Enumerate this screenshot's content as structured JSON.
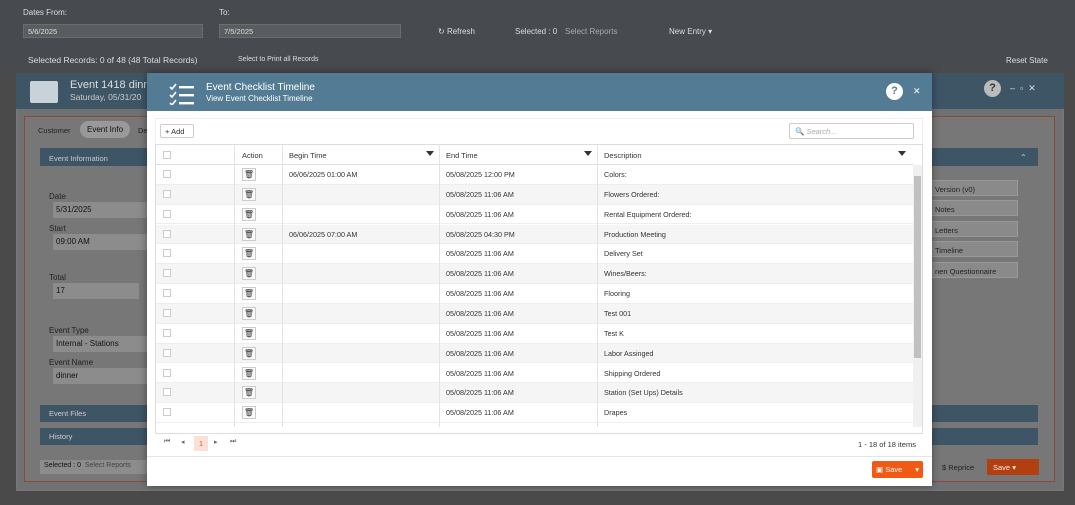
{
  "background": {
    "dates_from_label": "Dates From:",
    "dates_from": "5/6/2025",
    "to_label": "To:",
    "to": "7/5/2025",
    "refresh": "Refresh",
    "selected": "Selected : 0",
    "select_reports_placeholder": "Select Reports",
    "new_entry": "New Entry",
    "selected_records": "Selected Records: 0 of 48 (48 Total Records)",
    "select_to_print": "Select to Print all Records",
    "reset_state": "Reset State",
    "event_title": "Event 1418 dinner",
    "event_date": "Saturday, 05/31/20",
    "tabs": [
      "Customer",
      "Event Info",
      "De"
    ],
    "event_information": "Event Information",
    "date_label": "Date",
    "date_value": "5/31/2025",
    "start_label": "Start",
    "start_value": "09:00 AM",
    "total_label": "Total",
    "total_value": "17",
    "event_type_label": "Event Type",
    "event_type_value": "Internal - Stations",
    "event_name_label": "Event Name",
    "event_name_value": "dinner",
    "event_files": "Event Files",
    "history": "History",
    "footer_selected": "Selected : 0",
    "footer_select_reports": "Select Reports",
    "reprice": "Reprice",
    "save": "Save",
    "side_buttons": [
      "Version (v0)",
      "Notes",
      "Letters",
      "Timeline",
      "nen Questionnaire"
    ]
  },
  "modal": {
    "title": "Event Checklist Timeline",
    "subtitle": "View Event Checklist Timeline",
    "add_label": "Add",
    "search_placeholder": "Search...",
    "columns": [
      "Action",
      "Begin Time",
      "End Time",
      "Description"
    ],
    "rows": [
      {
        "begin": "06/06/2025 01:00 AM",
        "end": "05/08/2025 12:00 PM",
        "desc": "Colors:"
      },
      {
        "begin": "",
        "end": "05/08/2025 11:06 AM",
        "desc": "Flowers Ordered:"
      },
      {
        "begin": "",
        "end": "05/08/2025 11:06 AM",
        "desc": "Rental Equipment Ordered:"
      },
      {
        "begin": "06/06/2025 07:00 AM",
        "end": "05/08/2025 04:30 PM",
        "desc": "Production Meeting"
      },
      {
        "begin": "",
        "end": "05/08/2025 11:06 AM",
        "desc": "Delivery Set"
      },
      {
        "begin": "",
        "end": "05/08/2025 11:06 AM",
        "desc": "Wines/Beers:"
      },
      {
        "begin": "",
        "end": "05/08/2025 11:06 AM",
        "desc": "Flooring"
      },
      {
        "begin": "",
        "end": "05/08/2025 11:06 AM",
        "desc": "Test 001"
      },
      {
        "begin": "",
        "end": "05/08/2025 11:06 AM",
        "desc": "Test K"
      },
      {
        "begin": "",
        "end": "05/08/2025 11:06 AM",
        "desc": "Labor Assinged"
      },
      {
        "begin": "",
        "end": "05/08/2025 11:06 AM",
        "desc": "Shipping Ordered"
      },
      {
        "begin": "",
        "end": "05/08/2025 11:06 AM",
        "desc": "Station (Set Ups) Details"
      },
      {
        "begin": "",
        "end": "05/08/2025 11:06 AM",
        "desc": "Drapes"
      }
    ],
    "page": "1",
    "pager_info": "1 - 18 of 18 items",
    "save_label": "Save",
    "accent": "#537c94",
    "save_color": "#f05a14"
  }
}
